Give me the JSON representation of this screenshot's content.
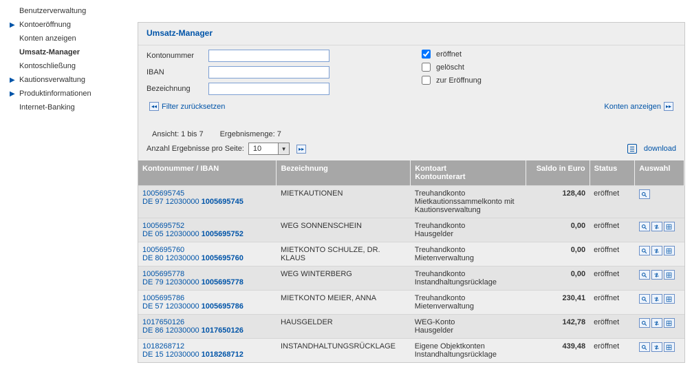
{
  "sidebar": {
    "items": [
      {
        "label": "Benutzerverwaltung",
        "arrow": false,
        "active": false
      },
      {
        "label": "Kontoeröffnung",
        "arrow": true,
        "active": false
      },
      {
        "label": "Konten anzeigen",
        "arrow": false,
        "active": false
      },
      {
        "label": "Umsatz-Manager",
        "arrow": false,
        "active": true
      },
      {
        "label": "Kontoschließung",
        "arrow": false,
        "active": false
      },
      {
        "label": "Kautionsverwaltung",
        "arrow": true,
        "active": false
      },
      {
        "label": "Produktinformationen",
        "arrow": true,
        "active": false
      },
      {
        "label": "Internet-Banking",
        "arrow": false,
        "active": false
      }
    ]
  },
  "panel": {
    "title": "Umsatz-Manager",
    "filter": {
      "kontonummer_label": "Kontonummer",
      "kontonummer_value": "",
      "iban_label": "IBAN",
      "iban_value": "",
      "bezeichnung_label": "Bezeichnung",
      "bezeichnung_value": "",
      "eroeffnet_label": "eröffnet",
      "eroeffnet_checked": true,
      "geloescht_label": "gelöscht",
      "geloescht_checked": false,
      "zur_eroeffnung_label": "zur Eröffnung",
      "zur_eroeffnung_checked": false,
      "reset_label": "Filter zurücksetzen",
      "show_label": "Konten anzeigen"
    },
    "status": {
      "ansicht_label": "Ansicht: 1 bis 7",
      "ergebnis_label": "Ergebnismenge: 7",
      "perpage_label": "Anzahl Ergebnisse pro Seite:",
      "perpage_value": "10",
      "download_label": "download"
    },
    "table": {
      "headers": {
        "kn": "Kontonummer / IBAN",
        "bez": "Bezeichnung",
        "art1": "Kontoart",
        "art2": "Kontounterart",
        "saldo": "Saldo in Euro",
        "status": "Status",
        "auswahl": "Auswahl"
      },
      "rows": [
        {
          "kn": "1005695745",
          "iban_pre": "DE 97 12030000 ",
          "iban_hl": "1005695745",
          "bez": "MIETKAUTIONEN",
          "art1": "Treuhandkonto",
          "art2": "Mietkautionssammelkonto mit Kautionsverwaltung",
          "saldo": "128,40",
          "status": "eröffnet",
          "actions": [
            "view"
          ]
        },
        {
          "kn": "1005695752",
          "iban_pre": "DE 05 12030000 ",
          "iban_hl": "1005695752",
          "bez": "WEG SONNENSCHEIN",
          "art1": "Treuhandkonto",
          "art2": "Hausgelder",
          "saldo": "0,00",
          "status": "eröffnet",
          "actions": [
            "view",
            "transfer",
            "grid"
          ]
        },
        {
          "kn": "1005695760",
          "iban_pre": "DE 80 12030000 ",
          "iban_hl": "1005695760",
          "bez": "MIETKONTO SCHULZE, DR. KLAUS",
          "art1": "Treuhandkonto",
          "art2": "Mietenverwaltung",
          "saldo": "0,00",
          "status": "eröffnet",
          "actions": [
            "view",
            "transfer",
            "grid"
          ]
        },
        {
          "kn": "1005695778",
          "iban_pre": "DE 79 12030000 ",
          "iban_hl": "1005695778",
          "bez": "WEG WINTERBERG",
          "art1": "Treuhandkonto",
          "art2": "Instandhaltungsrücklage",
          "saldo": "0,00",
          "status": "eröffnet",
          "actions": [
            "view",
            "transfer",
            "grid"
          ]
        },
        {
          "kn": "1005695786",
          "iban_pre": "DE 57 12030000 ",
          "iban_hl": "1005695786",
          "bez": "MIETKONTO MEIER, ANNA",
          "art1": "Treuhandkonto",
          "art2": "Mietenverwaltung",
          "saldo": "230,41",
          "status": "eröffnet",
          "actions": [
            "view",
            "transfer",
            "grid"
          ]
        },
        {
          "kn": "1017650126",
          "iban_pre": "DE 86 12030000 ",
          "iban_hl": "1017650126",
          "bez": "HAUSGELDER",
          "art1": "WEG-Konto",
          "art2": "Hausgelder",
          "saldo": "142,78",
          "status": "eröffnet",
          "actions": [
            "view",
            "transfer",
            "grid"
          ]
        },
        {
          "kn": "1018268712",
          "iban_pre": "DE 15 12030000 ",
          "iban_hl": "1018268712",
          "bez": "INSTANDHALTUNGSRÜCKLAGE",
          "art1": "Eigene Objektkonten",
          "art2": "Instandhaltungsrücklage",
          "saldo": "439,48",
          "status": "eröffnet",
          "actions": [
            "view",
            "transfer",
            "grid"
          ]
        }
      ]
    }
  }
}
